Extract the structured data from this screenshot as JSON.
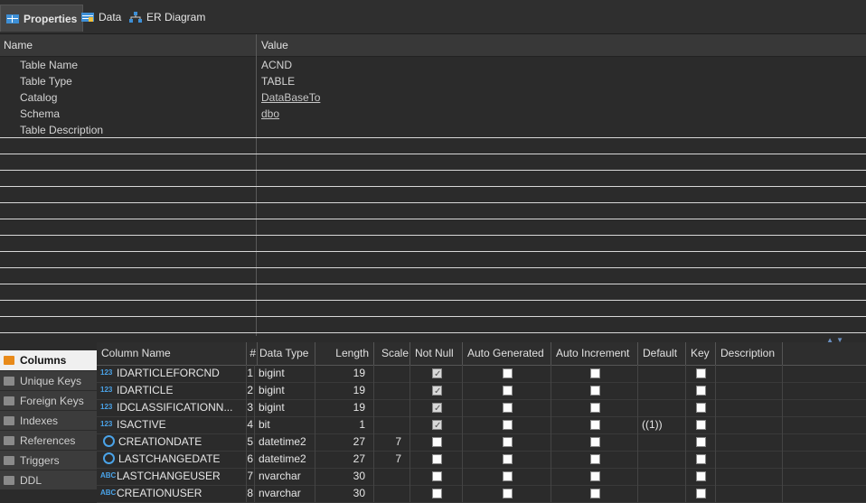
{
  "tabs": [
    {
      "label": "Properties",
      "icon": "properties-icon"
    },
    {
      "label": "Data",
      "icon": "data-grid-icon"
    },
    {
      "label": "ER Diagram",
      "icon": "er-diagram-icon"
    }
  ],
  "properties": {
    "header": {
      "name": "Name",
      "value": "Value"
    },
    "rows": [
      {
        "name": "Table Name",
        "value": "ACND",
        "link": false
      },
      {
        "name": "Table Type",
        "value": "TABLE",
        "link": false
      },
      {
        "name": "Catalog",
        "value": "DataBaseTo",
        "link": true
      },
      {
        "name": "Schema",
        "value": "dbo",
        "link": true
      },
      {
        "name": "Table Description",
        "value": "",
        "link": false
      }
    ]
  },
  "side_tabs": [
    {
      "label": "Columns",
      "active": true
    },
    {
      "label": "Unique Keys",
      "active": false
    },
    {
      "label": "Foreign Keys",
      "active": false
    },
    {
      "label": "Indexes",
      "active": false
    },
    {
      "label": "References",
      "active": false
    },
    {
      "label": "Triggers",
      "active": false
    },
    {
      "label": "DDL",
      "active": false
    }
  ],
  "columns_grid": {
    "headers": [
      "Column Name",
      "#",
      "Data Type",
      "Length",
      "Scale",
      "Not Null",
      "Auto Generated",
      "Auto Increment",
      "Default",
      "Key",
      "Description"
    ],
    "rows": [
      {
        "type_icon": "123",
        "name": "IDARTICLEFORCND",
        "num": "1",
        "data_type": "bigint",
        "length": "19",
        "scale": "",
        "not_null": true,
        "auto_gen": false,
        "auto_inc": false,
        "default": "",
        "key": false,
        "desc": ""
      },
      {
        "type_icon": "123",
        "name": "IDARTICLE",
        "num": "2",
        "data_type": "bigint",
        "length": "19",
        "scale": "",
        "not_null": true,
        "auto_gen": false,
        "auto_inc": false,
        "default": "",
        "key": false,
        "desc": ""
      },
      {
        "type_icon": "123",
        "name": "IDCLASSIFICATIONN...",
        "num": "3",
        "data_type": "bigint",
        "length": "19",
        "scale": "",
        "not_null": true,
        "auto_gen": false,
        "auto_inc": false,
        "default": "",
        "key": false,
        "desc": ""
      },
      {
        "type_icon": "123",
        "name": "ISACTIVE",
        "num": "4",
        "data_type": "bit",
        "length": "1",
        "scale": "",
        "not_null": true,
        "auto_gen": false,
        "auto_inc": false,
        "default": "((1))",
        "key": false,
        "desc": ""
      },
      {
        "type_icon": "clock",
        "name": "CREATIONDATE",
        "num": "5",
        "data_type": "datetime2",
        "length": "27",
        "scale": "7",
        "not_null": false,
        "auto_gen": false,
        "auto_inc": false,
        "default": "",
        "key": false,
        "desc": ""
      },
      {
        "type_icon": "clock",
        "name": "LASTCHANGEDATE",
        "num": "6",
        "data_type": "datetime2",
        "length": "27",
        "scale": "7",
        "not_null": false,
        "auto_gen": false,
        "auto_inc": false,
        "default": "",
        "key": false,
        "desc": ""
      },
      {
        "type_icon": "ABC",
        "name": "LASTCHANGEUSER",
        "num": "7",
        "data_type": "nvarchar",
        "length": "30",
        "scale": "",
        "not_null": false,
        "auto_gen": false,
        "auto_inc": false,
        "default": "",
        "key": false,
        "desc": ""
      },
      {
        "type_icon": "ABC",
        "name": "CREATIONUSER",
        "num": "8",
        "data_type": "nvarchar",
        "length": "30",
        "scale": "",
        "not_null": false,
        "auto_gen": false,
        "auto_inc": false,
        "default": "",
        "key": false,
        "desc": ""
      }
    ]
  }
}
